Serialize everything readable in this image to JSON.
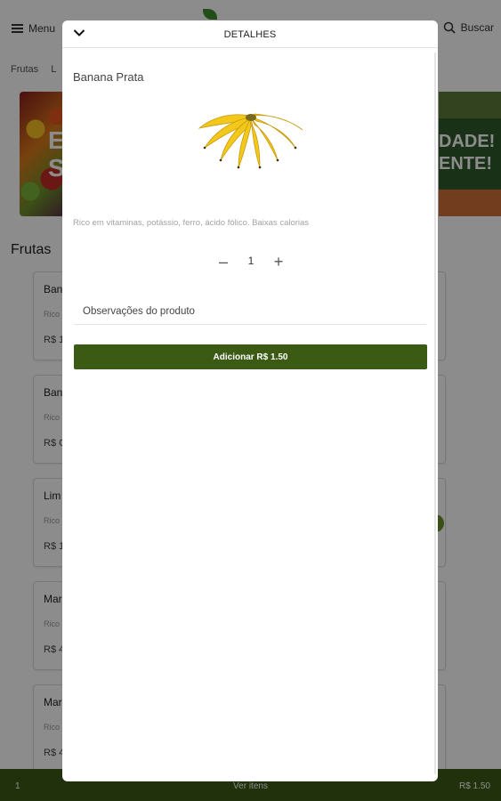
{
  "background": {
    "menu_label": "Menu",
    "search_label": "Buscar",
    "category_tabs": [
      "Frutas",
      "L"
    ],
    "banner_left_text": "E\nS",
    "banner_right_text": "DADE!\nENTE!",
    "section_title": "Frutas",
    "products": [
      {
        "name": "Ban",
        "desc": "Rico",
        "price": "R$ 1"
      },
      {
        "name": "Ban",
        "desc": "Rico",
        "price": "R$ C"
      },
      {
        "name": "Lim",
        "desc": "Rico",
        "price": "R$ 1"
      },
      {
        "name": "Mar",
        "desc": "Rico",
        "price": "R$ 4"
      },
      {
        "name": "Mar",
        "desc": "Rico",
        "price": "R$ 4"
      }
    ]
  },
  "cart_bar": {
    "count": "1",
    "view_label": "Ver itens",
    "total": "R$ 1.50"
  },
  "modal": {
    "title": "DETALHES",
    "product_name": "Banana Prata",
    "description": "Rico em vitaminas, potássio, ferro, ácido fólico. Baixas calorias",
    "quantity": "1",
    "minus_symbol": "–",
    "plus_symbol": "+",
    "notes_placeholder": "Observações do produto",
    "add_button_label": "Adicionar R$ 1.50"
  },
  "colors": {
    "brand_green": "#3b5a14",
    "banana_yellow": "#f2c81a"
  },
  "icons": [
    "hamburger-icon",
    "search-icon",
    "chevron-down-icon",
    "minus-icon",
    "plus-icon"
  ]
}
